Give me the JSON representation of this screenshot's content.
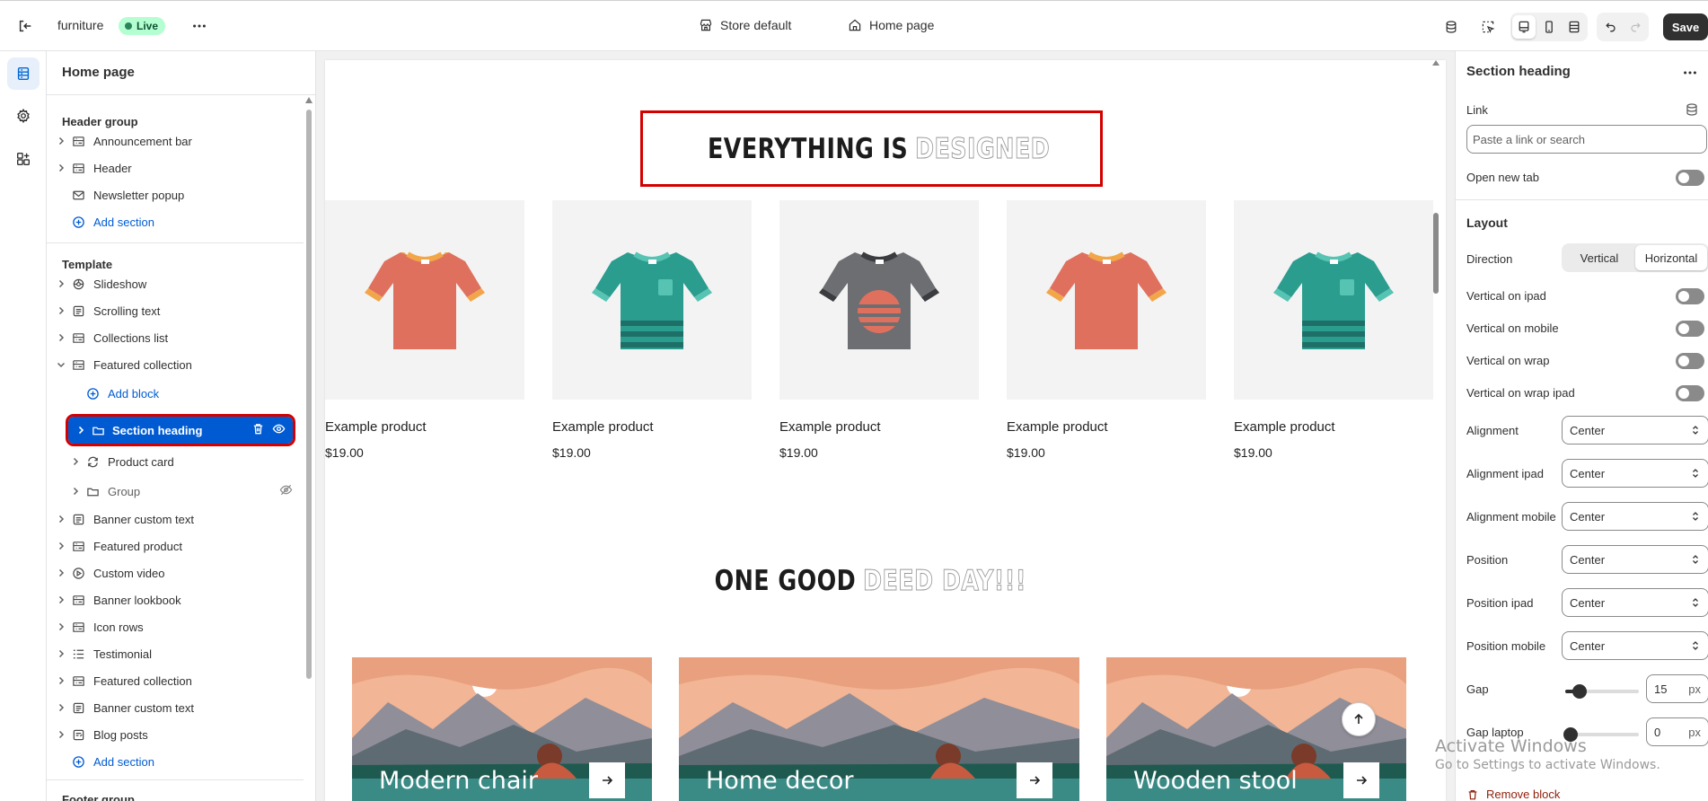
{
  "topbar": {
    "store_name": "furniture",
    "live_label": "Live",
    "store_default": "Store default",
    "page_selector": "Home page",
    "save_label": "Save"
  },
  "left_panel": {
    "title": "Home page",
    "header_group": {
      "title": "Header group",
      "items": [
        "Announcement bar",
        "Header",
        "Newsletter popup"
      ],
      "add_label": "Add section"
    },
    "template": {
      "title": "Template",
      "items": [
        "Slideshow",
        "Scrolling text",
        "Collections list",
        "Featured collection"
      ],
      "add_block_label": "Add block",
      "selected_block": "Section heading",
      "child_items": [
        "Product card",
        "Group"
      ],
      "rest_items": [
        "Banner custom text",
        "Featured product",
        "Custom video",
        "Banner lookbook",
        "Icon rows",
        "Testimonial",
        "Featured collection",
        "Banner custom text",
        "Blog posts"
      ],
      "add_label": "Add section"
    },
    "footer_group": {
      "title": "Footer group"
    }
  },
  "preview": {
    "heading1": {
      "solid": "EVERYTHING IS",
      "outline": "DESIGNED"
    },
    "products": [
      {
        "name": "Example product",
        "price": "$19.00",
        "shirt": "coral"
      },
      {
        "name": "Example product",
        "price": "$19.00",
        "shirt": "teal"
      },
      {
        "name": "Example product",
        "price": "$19.00",
        "shirt": "gray"
      },
      {
        "name": "Example product",
        "price": "$19.00",
        "shirt": "coral"
      },
      {
        "name": "Example product",
        "price": "$19.00",
        "shirt": "teal"
      }
    ],
    "heading2": {
      "solid": "ONE GOOD",
      "outline": "DEED DAY!!!"
    },
    "banners": [
      "Modern chair",
      "Home decor",
      "Wooden stool"
    ]
  },
  "right_panel": {
    "title": "Section heading",
    "link_label": "Link",
    "link_placeholder": "Paste a link or search",
    "open_new_tab": "Open new tab",
    "layout_title": "Layout",
    "direction_label": "Direction",
    "direction_options": [
      "Vertical",
      "Horizontal"
    ],
    "direction_selected": "Horizontal",
    "toggles": [
      "Vertical on ipad",
      "Vertical on mobile",
      "Vertical on wrap",
      "Vertical on wrap ipad"
    ],
    "selects": [
      {
        "label": "Alignment",
        "value": "Center"
      },
      {
        "label": "Alignment ipad",
        "value": "Center"
      },
      {
        "label": "Alignment mobile",
        "value": "Center"
      },
      {
        "label": "Position",
        "value": "Center"
      },
      {
        "label": "Position ipad",
        "value": "Center"
      },
      {
        "label": "Position mobile",
        "value": "Center"
      }
    ],
    "gap": {
      "label": "Gap",
      "value": "15",
      "unit": "px"
    },
    "gap_laptop": {
      "label": "Gap laptop",
      "value": "0",
      "unit": "px"
    },
    "remove_block": "Remove block"
  },
  "watermark": {
    "line1": "Activate Windows",
    "line2": "Go to Settings to activate Windows."
  },
  "colors": {
    "accent": "#005bd3",
    "selection_outline": "#d40000",
    "live_badge": "#b4fed2"
  }
}
